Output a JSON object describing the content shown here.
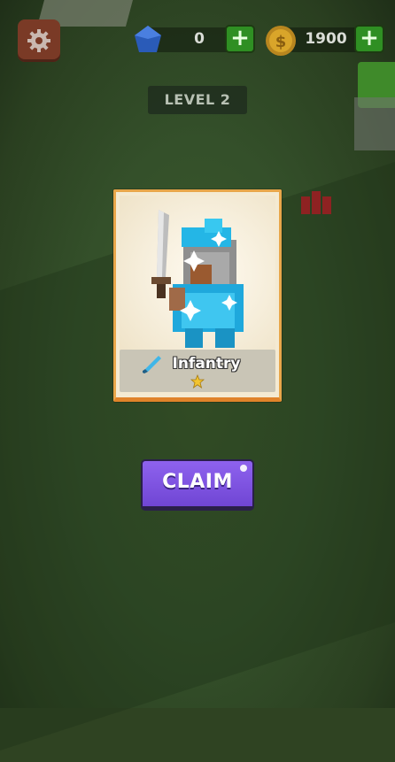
{
  "hud": {
    "gems": "0",
    "coins": "1900",
    "gem_plus": "+",
    "coin_plus": "+"
  },
  "level": {
    "label": "LEVEL 2"
  },
  "reward_card": {
    "unit_name": "Infantry",
    "stars": 1,
    "unit_icon": "sword-icon"
  },
  "actions": {
    "claim_label": "CLAIM"
  },
  "colors": {
    "claim_button": "#7f55e2",
    "card_border": "#e8a64a",
    "plus_button": "#2f8f23"
  }
}
